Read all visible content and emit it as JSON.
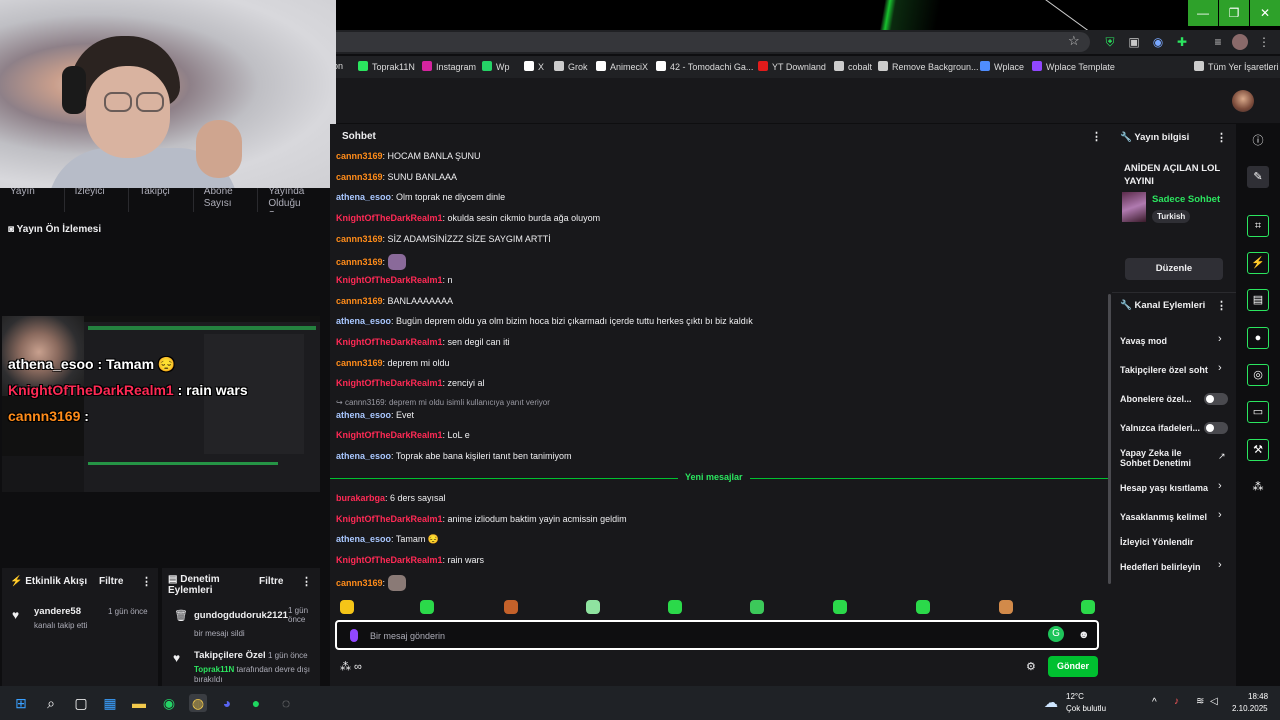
{
  "browser": {
    "bookmarks": [
      "ron",
      "Toprak11N",
      "Instagram",
      "Wp",
      "X",
      "Grok",
      "AnimeciX",
      "42 - Tomodachi Ga...",
      "YT Downland",
      "cobalt",
      "Remove Backgroun...",
      "Wplace",
      "Wplace Template",
      "Tüm Yer İşaretleri"
    ],
    "bookmark_colors": [
      "#888888",
      "#2be55f",
      "#d6249f",
      "#25d366",
      "#ffffff",
      "#cccccc",
      "#ffffff",
      "#ffffff",
      "#e21b1b",
      "#cccccc",
      "#cccccc",
      "#4f8dff",
      "#9147ff",
      "#cccccc"
    ]
  },
  "left": {
    "stats": [
      "Yayın",
      "İzleyici",
      "Takipçi",
      "Abone Sayısı",
      "Yayında Olduğu S..."
    ],
    "preview_title": "Yayın Ön İzlemesi",
    "overlay": [
      {
        "user": "athena_esoo",
        "text": " : Tamam 😔",
        "color": "#ffffff"
      },
      {
        "user": "KnightOfTheDarkRealm1",
        "text": " : rain wars",
        "color": "#ff2a55"
      },
      {
        "user": "cannn3169",
        "text": " :",
        "color": "#ff8c1a"
      }
    ],
    "activity": {
      "title": "Etkinlik Akışı",
      "filter": "Filtre",
      "user": "yandere58",
      "time": "1 gün önce",
      "desc": "kanalı takip etti"
    },
    "moderation": {
      "title": "Denetim Eylemleri",
      "filter": "Filtre",
      "item1_user": "gundogdudoruk2121",
      "item1_time": "1 gün önce",
      "item1_desc": "bir mesajı sildi",
      "item2_title": "Takipçilere Özel",
      "item2_time": "1 gün önce",
      "item2_user": "Toprak11N",
      "item2_desc": "tarafından devre dışı bırakıldı"
    }
  },
  "chat": {
    "title": "Sohbet",
    "messages": [
      {
        "user": "cannn3169",
        "color": "#ff8c1a",
        "text": ": HOCAM BANLA ŞUNU"
      },
      {
        "user": "cannn3169",
        "color": "#ff8c1a",
        "text": ": SUNU BANLAAA"
      },
      {
        "user": "athena_esoo",
        "color": "#a9c7ff",
        "text": ": Olm toprak ne diycem dinle"
      },
      {
        "user": "KnightOfTheDarkRealm1",
        "color": "#ff2a55",
        "text": ": okulda sesin cikmio burda ağa oluyom"
      },
      {
        "user": "cannn3169",
        "color": "#ff8c1a",
        "text": ": SİZ ADAMSİNİZZZ SİZE SAYGIM ARTTİ"
      },
      {
        "user": "cannn3169",
        "color": "#ff8c1a",
        "text": ":"
      },
      {
        "user": "KnightOfTheDarkRealm1",
        "color": "#ff2a55",
        "text": ": n"
      },
      {
        "user": "cannn3169",
        "color": "#ff8c1a",
        "text": ": BANLAAAAAAA"
      },
      {
        "user": "athena_esoo",
        "color": "#a9c7ff",
        "text": ": Bugün deprem oldu ya olm bizim hoca bizi çıkarmadı içerde tuttu herkes çıktı bı biz kaldık"
      },
      {
        "user": "KnightOfTheDarkRealm1",
        "color": "#ff2a55",
        "text": ": sen degil can iti"
      },
      {
        "user": "cannn3169",
        "color": "#ff8c1a",
        "text": ": deprem mi oldu"
      },
      {
        "user": "KnightOfTheDarkRealm1",
        "color": "#ff2a55",
        "text": ": zenciyi al"
      },
      {
        "user": "athena_esoo",
        "color": "#a9c7ff",
        "text": ": Evet"
      },
      {
        "user": "KnightOfTheDarkRealm1",
        "color": "#ff2a55",
        "text": ": LoL e"
      },
      {
        "user": "athena_esoo",
        "color": "#a9c7ff",
        "text": ": Toprak abe bana kişileri tanıt ben tanimiyom"
      },
      {
        "user": "burakarbga",
        "color": "#ff2a55",
        "text": ": 6 ders sayısal"
      },
      {
        "user": "KnightOfTheDarkRealm1",
        "color": "#ff2a55",
        "text": ": anime izliodum baktim yayin acmissin geldim"
      },
      {
        "user": "athena_esoo",
        "color": "#a9c7ff",
        "text": ": Tamam 😔"
      },
      {
        "user": "KnightOfTheDarkRealm1",
        "color": "#ff2a55",
        "text": ": rain wars"
      },
      {
        "user": "cannn3169",
        "color": "#ff8c1a",
        "text": ":"
      }
    ],
    "reply_note": "cannn3169: deprem mi oldu isimli kullanıcıya yanıt veriyor",
    "new_messages": "Yeni mesajlar",
    "placeholder": "Bir mesaj gönderin",
    "send": "Gönder"
  },
  "right": {
    "stream_info_title": "Yayın bilgisi",
    "stream_title": "ANİDEN AÇILAN LOL YAYINI",
    "category": "Sadece Sohbet",
    "language": "Turkish",
    "edit": "Düzenle",
    "channel_actions_title": "Kanal Eylemleri",
    "actions": [
      "Yavaş mod",
      "Takipçilere özel soht",
      "Abonelere özel...",
      "Yalnızca ifadeleri...",
      "Yapay Zeka ile Sohbet Denetimi",
      "Hesap yaşı kısıtlama",
      "Yasaklanmış kelimel",
      "İzleyici Yönlendir",
      "Hedefleri belirleyin"
    ]
  },
  "taskbar": {
    "weather_temp": "12°C",
    "weather_desc": "Çok bulutlu",
    "time": "18:48",
    "date": "2.10.2025"
  },
  "colors": {
    "accent": "#00c030",
    "accent_text": "#2be55f",
    "bg": "#0e0e10",
    "panel": "#18181b"
  }
}
